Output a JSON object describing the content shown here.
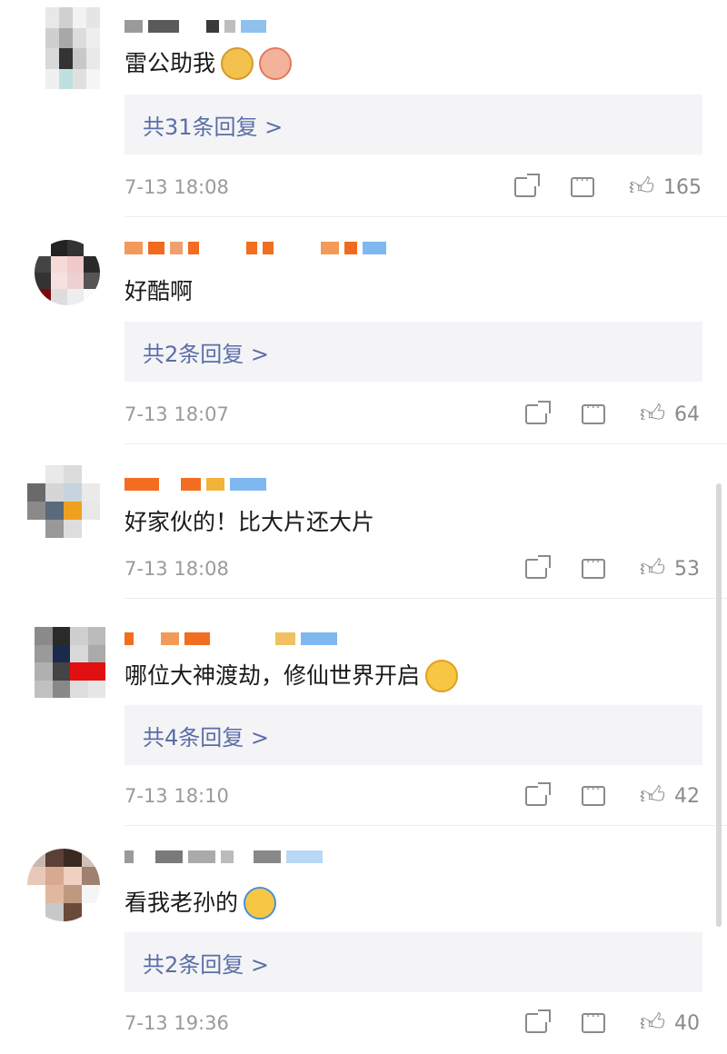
{
  "comments": [
    {
      "text": "雷公助我",
      "emojis": [
        "doge-emoji",
        "monkey-emoji"
      ],
      "replies": "共31条回复 >",
      "time": "7-13 18:08",
      "likes": "165",
      "has_replies": true
    },
    {
      "text": "好酷啊",
      "emojis": [],
      "replies": "共2条回复 >",
      "time": "7-13 18:07",
      "likes": "64",
      "has_replies": true
    },
    {
      "text": "好家伙的！比大片还大片",
      "emojis": [],
      "replies": "",
      "time": "7-13 18:08",
      "likes": "53",
      "has_replies": false
    },
    {
      "text": "哪位大神渡劫，修仙世界开启",
      "emojis": [
        "grin-sweat-emoji"
      ],
      "replies": "共4条回复 >",
      "time": "7-13 18:10",
      "likes": "42",
      "has_replies": true
    },
    {
      "text": "看我老孙的",
      "emojis": [
        "laughing-crying-emoji"
      ],
      "replies": "共2条回复 >",
      "time": "7-13 19:36",
      "likes": "40",
      "has_replies": true
    }
  ],
  "colors": {
    "reply_link": "#5a6ea8",
    "meta": "#9a9a9a",
    "reply_bg": "#f4f4f6"
  }
}
